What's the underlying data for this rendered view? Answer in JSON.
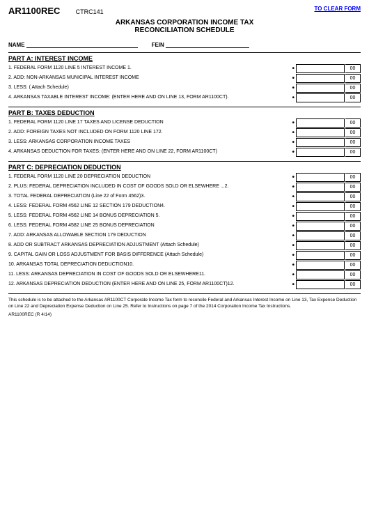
{
  "header": {
    "form_id": "AR1100REC",
    "ctrc": "CTRC141",
    "clear_form_label": "TO CLEAR FORM"
  },
  "title": {
    "line1": "ARKANSAS CORPORATION INCOME TAX",
    "line2": "RECONCILIATION SCHEDULE"
  },
  "fields": {
    "name_label": "NAME",
    "fein_label": "FEIN"
  },
  "parts": {
    "part_a": {
      "header": "PART A: INTEREST INCOME",
      "rows": [
        "1. FEDERAL FORM 1120 LINE 5 INTEREST INCOME  1.",
        "2. ADD: NON-ARKANSAS MUNICIPAL INTEREST INCOME",
        "3. LESS:  ( Attach Schedule)",
        "4. ARKANSAS TAXABLE INTEREST INCOME: (ENTER HERE AND ON LINE 13, FORM AR1100CT).",
        ""
      ]
    },
    "part_b": {
      "header": "PART B: TAXES DEDUCTION",
      "rows": [
        "1. FEDERAL FORM 1120 LINE 17 TAXES AND LICENSE DEDUCTION",
        "2. ADD: FOREIGN TAXES NOT INCLUDED ON FORM 1120 LINE 172.",
        "3. LESS: ARKANSAS CORPORATION INCOME TAXES",
        "4. ARKANSAS DEDUCTION FOR TAXES: (ENTER HERE AND ON LINE 22, FORM AR1100CT)"
      ]
    },
    "part_c": {
      "header": "PART C: DEPRECIATION DEDUCTION",
      "rows": [
        "1. FEDERAL FORM 1120 LINE 20 DEPRECIATION DEDUCTION",
        "2. PLUS: FEDERAL DEPRECIATION INCLUDED IN COST OF GOODS SOLD OR ELSEWHERE  ...2.",
        "3. TOTAL FEDERAL DEPRECIATION (Line 22 of Form 4562)3.",
        "4. LESS: FEDERAL FORM 4562 LINE 12 SECTION 179 DEDUCTION4.",
        "5. LESS: FEDERAL FORM 4562 LINE 14 BONUS DEPRECIATION  5.",
        "6. LESS: FEDERAL FORM 4582 LINE 25 BONUS DEPRECIATION",
        "7. ADD: ARKANSAS ALLOWABLE SECTION 179 DEDUCTION",
        "8. ADD OR SUBTRACT ARKANSAS DEPRECIATION ADJUSTMENT (Attach Schedule)",
        "9. CAPITAL GAIN OR LOSS ADJUSTMENT FOR BASIS DIFFERENCE (Attach Schedule)",
        "10. ARKANSAS TOTAL DEPRECIATION DEDUCTION10.",
        "11. LESS: ARKANSAS DEPRECIATION IN COST OF GOODS SOLD OR ELSEWHERE11.",
        "12. ARKANSAS DEPRECIATION DEDUCTION (ENTER HERE AND ON LINE 25, FORM AR1100CT)12."
      ]
    }
  },
  "footer": {
    "note": "This schedule is to be attached to the Arkansas AR1100CT Corporate Income Tax form to reconcile Federal and Arkansas Interest Income on Line 13, Tax Expense Deduction on Line 22 and Depreciation Expense Deduction on Line 25. Refer to Instructions on page 7 of the 2014 Corporation Income Tax Instructions.",
    "form_ref": "AR1100REC (R 4/14)"
  },
  "cents": "00"
}
